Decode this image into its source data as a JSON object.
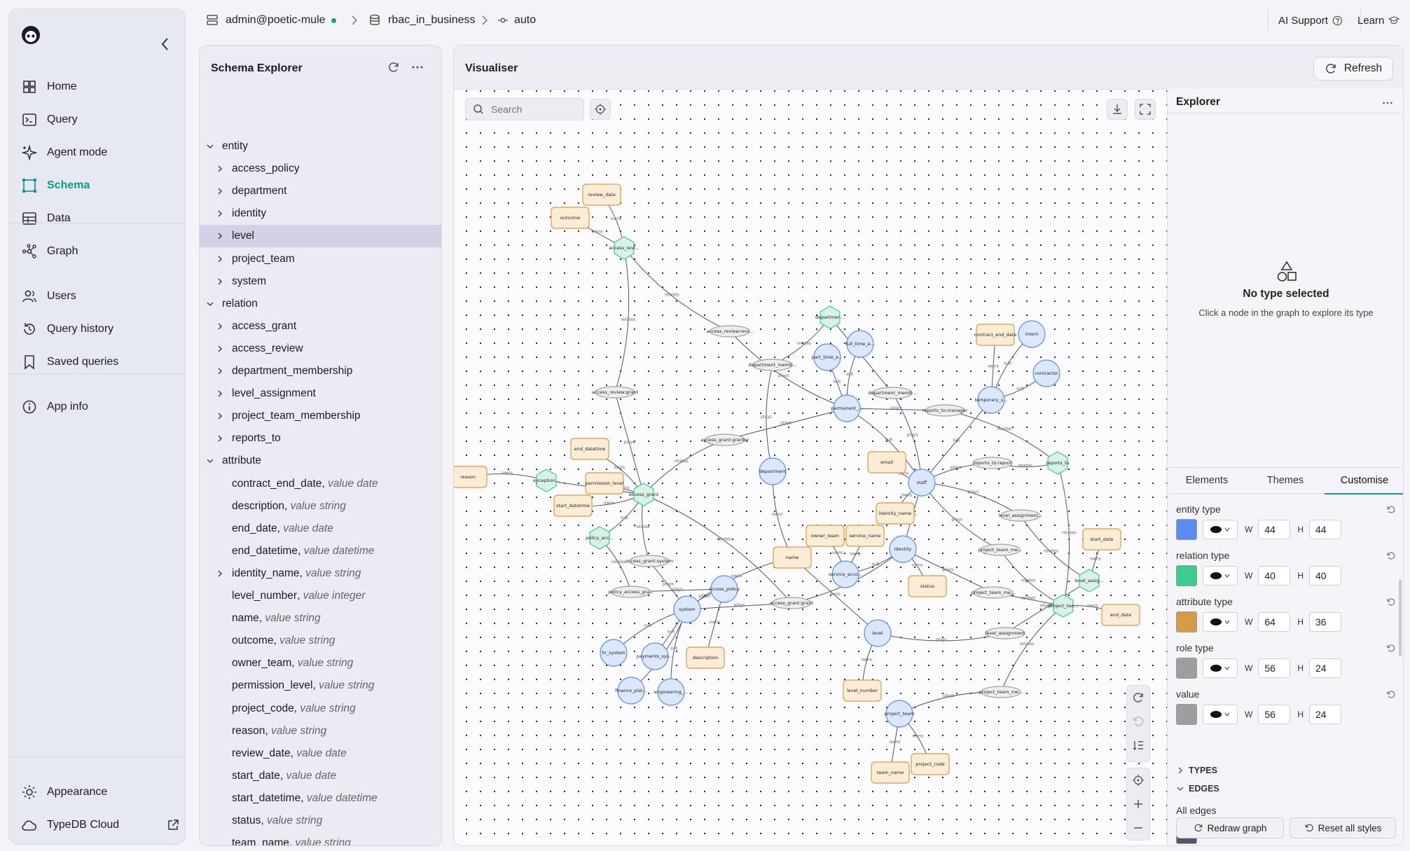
{
  "nav": {
    "items": [
      {
        "label": "Home",
        "icon": "home-icon"
      },
      {
        "label": "Query",
        "icon": "terminal-icon"
      },
      {
        "label": "Agent mode",
        "icon": "sparkle-icon"
      },
      {
        "label": "Schema",
        "icon": "schema-icon",
        "active": true
      },
      {
        "label": "Data",
        "icon": "table-icon"
      },
      {
        "label": "Graph",
        "icon": "graph-icon"
      },
      {
        "label": "Users",
        "icon": "users-icon"
      },
      {
        "label": "Query history",
        "icon": "history-icon"
      },
      {
        "label": "Saved queries",
        "icon": "bookmark-icon"
      },
      {
        "label": "App info",
        "icon": "info-icon"
      }
    ],
    "bottom": [
      {
        "label": "Appearance",
        "icon": "sun-icon"
      },
      {
        "label": "TypeDB Cloud",
        "icon": "cloud-icon"
      }
    ]
  },
  "topbar": {
    "connection": "admin@poetic-mule",
    "database": "rbac_in_business",
    "transaction": "auto",
    "ai_support": "AI Support",
    "learn": "Learn"
  },
  "schema_explorer": {
    "title": "Schema Explorer",
    "rows": [
      {
        "label": "entity",
        "kind": "group"
      },
      {
        "label": "access_policy",
        "kind": "child"
      },
      {
        "label": "department",
        "kind": "child"
      },
      {
        "label": "identity",
        "kind": "child"
      },
      {
        "label": "level",
        "kind": "child",
        "selected": true
      },
      {
        "label": "project_team",
        "kind": "child"
      },
      {
        "label": "system",
        "kind": "child"
      },
      {
        "label": "relation",
        "kind": "group"
      },
      {
        "label": "access_grant",
        "kind": "child"
      },
      {
        "label": "access_review",
        "kind": "child"
      },
      {
        "label": "department_membership",
        "kind": "child"
      },
      {
        "label": "level_assignment",
        "kind": "child"
      },
      {
        "label": "project_team_membership",
        "kind": "child"
      },
      {
        "label": "reports_to",
        "kind": "child"
      },
      {
        "label": "attribute",
        "kind": "group"
      },
      {
        "label": "contract_end_date",
        "type": "value date",
        "kind": "leaf"
      },
      {
        "label": "description",
        "type": "value string",
        "kind": "leaf"
      },
      {
        "label": "end_date",
        "type": "value date",
        "kind": "leaf"
      },
      {
        "label": "end_datetime",
        "type": "value datetime",
        "kind": "leaf"
      },
      {
        "label": "identity_name",
        "type": "value string",
        "kind": "child"
      },
      {
        "label": "level_number",
        "type": "value integer",
        "kind": "leaf"
      },
      {
        "label": "name",
        "type": "value string",
        "kind": "leaf"
      },
      {
        "label": "outcome",
        "type": "value string",
        "kind": "leaf"
      },
      {
        "label": "owner_team",
        "type": "value string",
        "kind": "leaf"
      },
      {
        "label": "permission_level",
        "type": "value string",
        "kind": "leaf"
      },
      {
        "label": "project_code",
        "type": "value string",
        "kind": "leaf"
      },
      {
        "label": "reason",
        "type": "value string",
        "kind": "leaf"
      },
      {
        "label": "review_date",
        "type": "value date",
        "kind": "leaf"
      },
      {
        "label": "start_date",
        "type": "value date",
        "kind": "leaf"
      },
      {
        "label": "start_datetime",
        "type": "value datetime",
        "kind": "leaf"
      },
      {
        "label": "status",
        "type": "value string",
        "kind": "leaf"
      },
      {
        "label": "team_name",
        "type": "value string",
        "kind": "leaf"
      }
    ]
  },
  "visualiser": {
    "title": "Visualiser",
    "refresh_label": "Refresh",
    "search_placeholder": "Search",
    "graph": {
      "nodes": [
        {
          "id": "review_date",
          "label": "review_date",
          "kind": "attribute"
        },
        {
          "id": "outcome",
          "label": "outcome",
          "kind": "attribute"
        },
        {
          "id": "access_review",
          "label": "access_revi...",
          "kind": "relation"
        },
        {
          "id": "ar_reviewer",
          "label": "access_review:revi...",
          "kind": "role"
        },
        {
          "id": "ar_grant",
          "label": "access_review:grant",
          "kind": "role"
        },
        {
          "id": "department_membership",
          "label": "departmen...",
          "kind": "relation"
        },
        {
          "id": "part_time",
          "label": "part_time_e...",
          "kind": "entity"
        },
        {
          "id": "full_time",
          "label": "full_time_e...",
          "kind": "entity"
        },
        {
          "id": "dm_role1",
          "label": "department_memb...",
          "kind": "role"
        },
        {
          "id": "dm_role2",
          "label": "department_memb...",
          "kind": "role"
        },
        {
          "id": "permanent",
          "label": "permanent_...",
          "kind": "entity"
        },
        {
          "id": "contract_end_date",
          "label": "contract_end_date",
          "kind": "attribute"
        },
        {
          "id": "intern",
          "label": "intern",
          "kind": "entity"
        },
        {
          "id": "contractor",
          "label": "contractor",
          "kind": "entity"
        },
        {
          "id": "temporary",
          "label": "temporary_s...",
          "kind": "entity"
        },
        {
          "id": "rt_manager",
          "label": "reports_to:manager",
          "kind": "role"
        },
        {
          "id": "rt_report",
          "label": "reports_to:report",
          "kind": "role"
        },
        {
          "id": "reports_to",
          "label": "reports_to",
          "kind": "relation"
        },
        {
          "id": "end_datetime",
          "label": "end_datetime",
          "kind": "attribute"
        },
        {
          "id": "ag_grantor",
          "label": "access_grant:grantor",
          "kind": "role"
        },
        {
          "id": "reason",
          "label": "reason",
          "kind": "attribute"
        },
        {
          "id": "exception",
          "label": "exception...",
          "kind": "relation"
        },
        {
          "id": "permission_level",
          "label": "permission_level",
          "kind": "attribute"
        },
        {
          "id": "access_grant",
          "label": "access_grant",
          "kind": "relation"
        },
        {
          "id": "start_datetime",
          "label": "start_datetime",
          "kind": "attribute"
        },
        {
          "id": "department",
          "label": "department",
          "kind": "entity"
        },
        {
          "id": "email",
          "label": "email",
          "kind": "attribute"
        },
        {
          "id": "staff",
          "label": "staff",
          "kind": "entity"
        },
        {
          "id": "identity_name",
          "label": "identity_name",
          "kind": "attribute"
        },
        {
          "id": "la_role1",
          "label": "level_assignment...",
          "kind": "role"
        },
        {
          "id": "policy_acc",
          "label": "policy_acc...",
          "kind": "relation"
        },
        {
          "id": "owner_team",
          "label": "owner_team",
          "kind": "attribute"
        },
        {
          "id": "service_name",
          "label": "service_name",
          "kind": "attribute"
        },
        {
          "id": "name",
          "label": "name",
          "kind": "attribute"
        },
        {
          "id": "identity",
          "label": "identity",
          "kind": "entity"
        },
        {
          "id": "ag_system",
          "label": "access_grant:system",
          "kind": "role"
        },
        {
          "id": "service_acc",
          "label": "service_acco...",
          "kind": "entity"
        },
        {
          "id": "ptm_role1",
          "label": "project_team_me...",
          "kind": "role"
        },
        {
          "id": "start_date",
          "label": "start_date",
          "kind": "attribute"
        },
        {
          "id": "pa_role",
          "label": "policy_access_gra...",
          "kind": "role"
        },
        {
          "id": "access_policy",
          "label": "access_policy",
          "kind": "entity"
        },
        {
          "id": "status",
          "label": "status",
          "kind": "attribute"
        },
        {
          "id": "ptm_role2",
          "label": "project_team_me...",
          "kind": "role"
        },
        {
          "id": "level_assignment",
          "label": "level_assig...",
          "kind": "relation"
        },
        {
          "id": "ag_grant",
          "label": "access_grant:grant",
          "kind": "role"
        },
        {
          "id": "project_team_membership",
          "label": "project_tea...",
          "kind": "relation"
        },
        {
          "id": "end_date",
          "label": "end_date",
          "kind": "attribute"
        },
        {
          "id": "system",
          "label": "system",
          "kind": "entity"
        },
        {
          "id": "level",
          "label": "level",
          "kind": "entity"
        },
        {
          "id": "la_role2",
          "label": "level_assignment",
          "kind": "role"
        },
        {
          "id": "hr_system",
          "label": "hr_system",
          "kind": "entity"
        },
        {
          "id": "payments_sys",
          "label": "payments_sys...",
          "kind": "entity"
        },
        {
          "id": "description",
          "label": "description",
          "kind": "attribute"
        },
        {
          "id": "finance_plat",
          "label": "finance_plat...",
          "kind": "entity"
        },
        {
          "id": "engineering",
          "label": "engineering_...",
          "kind": "entity"
        },
        {
          "id": "level_number",
          "label": "level_number",
          "kind": "attribute"
        },
        {
          "id": "ptm_role3",
          "label": "project_team_me...",
          "kind": "role"
        },
        {
          "id": "project_team",
          "label": "project_team",
          "kind": "entity"
        },
        {
          "id": "team_name",
          "label": "team_name",
          "kind": "attribute"
        },
        {
          "id": "project_code",
          "label": "project_code",
          "kind": "attribute"
        }
      ],
      "edges": [
        [
          "review_date",
          "access_review",
          "owns"
        ],
        [
          "outcome",
          "access_review",
          "owns"
        ],
        [
          "access_review",
          "ar_reviewer",
          "relates"
        ],
        [
          "access_review",
          "ar_grant",
          "relates"
        ],
        [
          "ar_grant",
          "access_grant",
          "plays"
        ],
        [
          "ar_reviewer",
          "permanent",
          "plays"
        ],
        [
          "department_membership",
          "dm_role1",
          "relates"
        ],
        [
          "department_membership",
          "dm_role2",
          "relates"
        ],
        [
          "dm_role1",
          "department",
          "plays"
        ],
        [
          "dm_role2",
          "staff",
          "plays"
        ],
        [
          "part_time",
          "permanent",
          "sub"
        ],
        [
          "full_time",
          "permanent",
          "sub"
        ],
        [
          "permanent",
          "staff",
          "sub"
        ],
        [
          "temporary",
          "staff",
          "sub"
        ],
        [
          "intern",
          "temporary",
          "sub"
        ],
        [
          "contractor",
          "temporary",
          "sub"
        ],
        [
          "contract_end_date",
          "temporary",
          "owns"
        ],
        [
          "reports_to",
          "rt_manager",
          "relates"
        ],
        [
          "reports_to",
          "rt_report",
          "relates"
        ],
        [
          "rt_manager",
          "permanent",
          "plays"
        ],
        [
          "rt_report",
          "staff",
          "plays"
        ],
        [
          "end_datetime",
          "access_grant",
          "owns"
        ],
        [
          "permission_level",
          "access_grant",
          "owns"
        ],
        [
          "start_datetime",
          "access_grant",
          "owns"
        ],
        [
          "access_grant",
          "ag_grantor",
          "relates"
        ],
        [
          "ag_grantor",
          "permanent",
          "plays"
        ],
        [
          "access_grant",
          "ag_system",
          "relates"
        ],
        [
          "access_grant",
          "ag_grant",
          "relates"
        ],
        [
          "ag_system",
          "system",
          "plays"
        ],
        [
          "ag_grant",
          "identity",
          "plays"
        ],
        [
          "reason",
          "exception",
          "owns"
        ],
        [
          "exception",
          "access_grant",
          "sub"
        ],
        [
          "policy_acc",
          "access_grant",
          "sub"
        ],
        [
          "policy_acc",
          "pa_role",
          "relates"
        ],
        [
          "pa_role",
          "access_policy",
          "plays"
        ],
        [
          "email",
          "staff",
          "owns"
        ],
        [
          "identity_name",
          "staff",
          "owns"
        ],
        [
          "staff",
          "identity",
          "sub"
        ],
        [
          "service_acc",
          "identity",
          "sub"
        ],
        [
          "owner_team",
          "service_acc",
          "owns"
        ],
        [
          "service_name",
          "service_acc",
          "owns"
        ],
        [
          "name",
          "system",
          "owns"
        ],
        [
          "name",
          "department",
          "owns"
        ],
        [
          "name",
          "level",
          "owns"
        ],
        [
          "status",
          "identity",
          "owns"
        ],
        [
          "level_assignment",
          "la_role1",
          "relates"
        ],
        [
          "level_assignment",
          "la_role2",
          "relates"
        ],
        [
          "la_role1",
          "staff",
          "plays"
        ],
        [
          "la_role2",
          "level",
          "plays"
        ],
        [
          "start_date",
          "level_assignment",
          "owns"
        ],
        [
          "end_date",
          "project_team_membership",
          "owns"
        ],
        [
          "project_team_membership",
          "ptm_role1",
          "relates"
        ],
        [
          "project_team_membership",
          "ptm_role2",
          "relates"
        ],
        [
          "project_team_membership",
          "ptm_role3",
          "relates"
        ],
        [
          "ptm_role1",
          "staff",
          "plays"
        ],
        [
          "ptm_role2",
          "identity",
          "plays"
        ],
        [
          "ptm_role3",
          "project_team",
          "plays"
        ],
        [
          "hr_system",
          "system",
          "sub"
        ],
        [
          "payments_sys",
          "system",
          "sub"
        ],
        [
          "finance_plat",
          "system",
          "sub"
        ],
        [
          "engineering",
          "system",
          "sub"
        ],
        [
          "description",
          "access_policy",
          "owns"
        ],
        [
          "access_policy",
          "system",
          "plays"
        ],
        [
          "level_number",
          "level",
          "owns"
        ],
        [
          "team_name",
          "project_team",
          "owns"
        ],
        [
          "project_code",
          "project_team",
          "owns"
        ],
        [
          "reports_to",
          "project_team_membership",
          "relates"
        ],
        [
          "ag_grant",
          "system",
          "plays"
        ]
      ]
    }
  },
  "explorer": {
    "title": "Explorer",
    "empty_title": "No type selected",
    "empty_subtitle": "Click a node in the graph to explore its type",
    "tabs": [
      "Elements",
      "Themes",
      "Customise"
    ],
    "active_tab": "Customise",
    "style_rows": [
      {
        "label": "entity type",
        "color": "#5b8def",
        "w": "44",
        "h": "44"
      },
      {
        "label": "relation type",
        "color": "#3dcc8f",
        "w": "40",
        "h": "40"
      },
      {
        "label": "attribute type",
        "color": "#d79b48",
        "w": "64",
        "h": "36"
      },
      {
        "label": "role type",
        "color": "#9e9e9e",
        "w": "56",
        "h": "24"
      },
      {
        "label": "value",
        "color": "#9e9e9e",
        "w": "56",
        "h": "24"
      }
    ],
    "w_label": "W",
    "h_label": "H",
    "types_label": "TYPES",
    "edges_label": "EDGES",
    "all_edges_label": "All edges",
    "all_edges_color": "#55546b",
    "redraw_label": "Redraw graph",
    "reset_label": "Reset all styles"
  }
}
